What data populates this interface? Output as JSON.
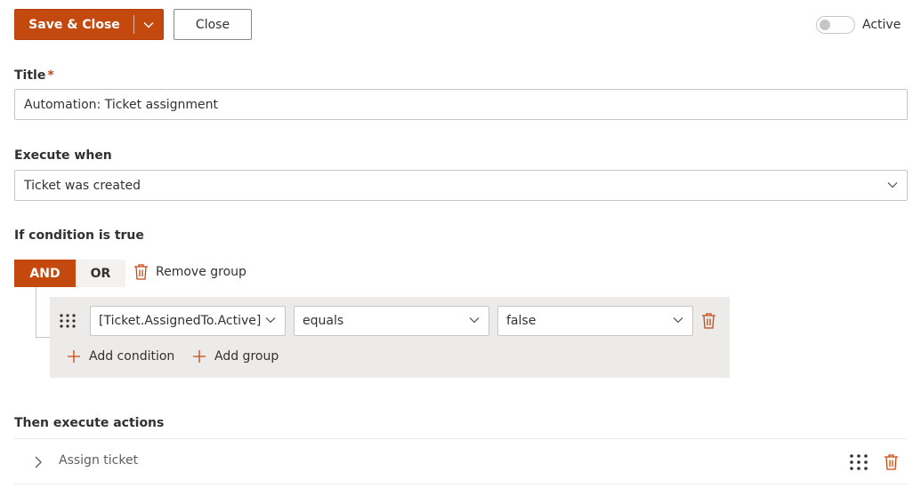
{
  "toolbar": {
    "save_close_label": "Save & Close",
    "close_label": "Close",
    "active_label": "Active",
    "active_on": false
  },
  "title_field": {
    "label": "Title",
    "required_mark": "*",
    "value": "Automation: Ticket assignment"
  },
  "execute_when": {
    "label": "Execute when",
    "value": "Ticket was created"
  },
  "condition": {
    "label": "If condition is true",
    "and_label": "AND",
    "or_label": "OR",
    "selected_operator": "AND",
    "remove_group_label": "Remove group",
    "rows": [
      {
        "field": "[Ticket.AssignedTo.Active]",
        "operator": "equals",
        "value": "false"
      }
    ],
    "add_condition_label": "Add condition",
    "add_group_label": "Add group"
  },
  "actions": {
    "label": "Then execute actions",
    "items": [
      {
        "label": "Assign ticket"
      }
    ]
  },
  "colors": {
    "accent": "#c4490f",
    "group_bg": "#edebe9"
  }
}
